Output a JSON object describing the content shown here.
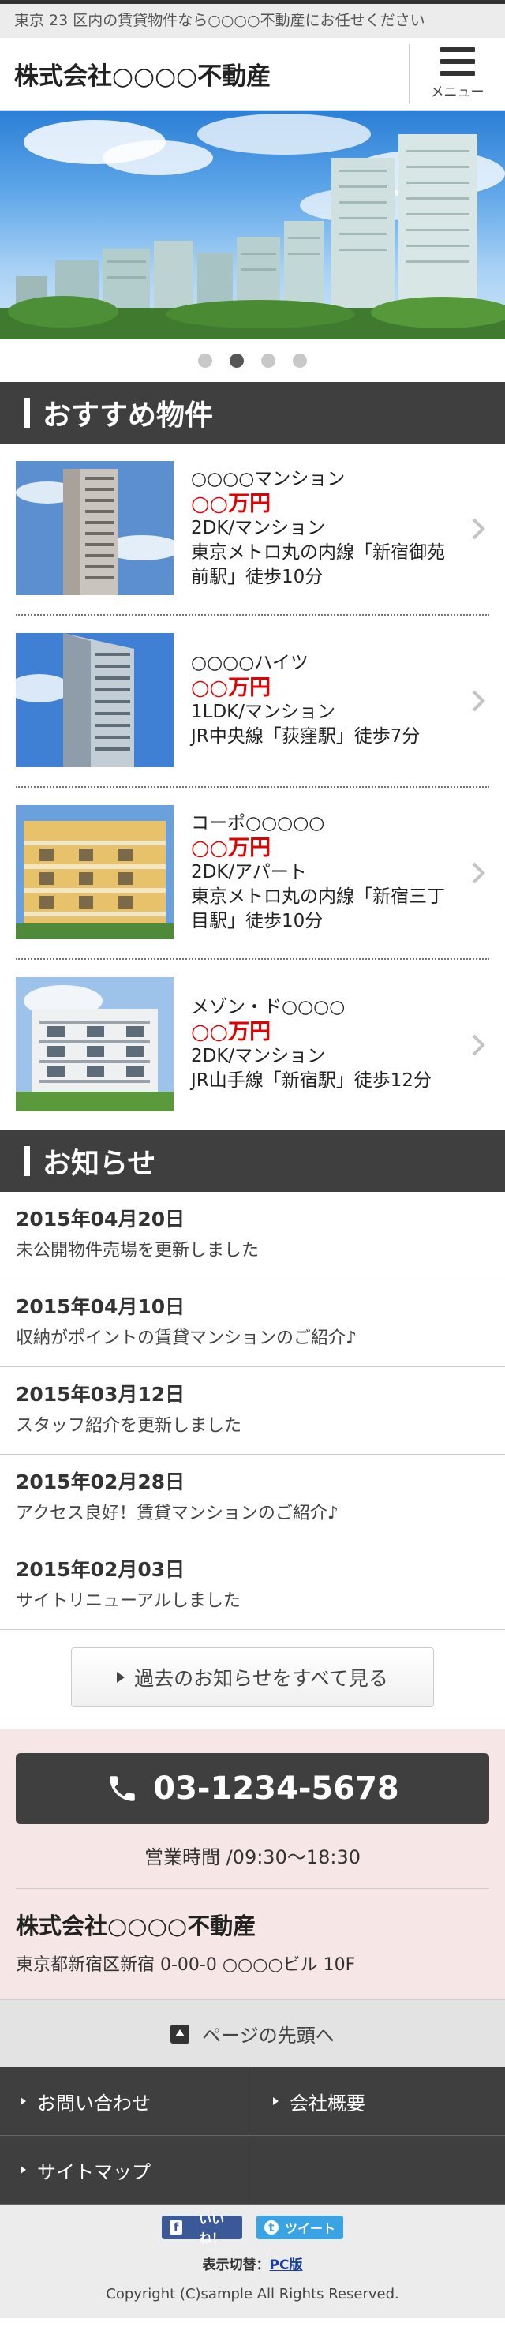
{
  "topbar": {
    "text": "東京 23 区内の賃貸物件なら○○○○不動産にお任せください"
  },
  "header": {
    "title": "株式会社○○○○不動産",
    "menu_label": "メニュー"
  },
  "slider": {
    "dots": 4,
    "active": 1
  },
  "recommend": {
    "heading": "おすすめ物件",
    "items": [
      {
        "name": "○○○○マンション",
        "price": "○○万円",
        "type": "2DK/マンション",
        "access": "東京メトロ丸の内線「新宿御苑前駅」徒歩10分"
      },
      {
        "name": "○○○○ハイツ",
        "price": "○○万円",
        "type": "1LDK/マンション",
        "access": "JR中央線「荻窪駅」徒歩7分"
      },
      {
        "name": "コーポ○○○○○",
        "price": "○○万円",
        "type": "2DK/アパート",
        "access": "東京メトロ丸の内線「新宿三丁目駅」徒歩10分"
      },
      {
        "name": "メゾン・ド○○○○",
        "price": "○○万円",
        "type": "2DK/マンション",
        "access": "JR山手線「新宿駅」徒歩12分"
      }
    ]
  },
  "news": {
    "heading": "お知らせ",
    "items": [
      {
        "date": "2015年04月20日",
        "title": "未公開物件売場を更新しました"
      },
      {
        "date": "2015年04月10日",
        "title": "収納がポイントの賃貸マンションのご紹介♪"
      },
      {
        "date": "2015年03月12日",
        "title": "スタッフ紹介を更新しました"
      },
      {
        "date": "2015年02月28日",
        "title": "アクセス良好！賃貸マンションのご紹介♪"
      },
      {
        "date": "2015年02月03日",
        "title": "サイトリニューアルしました"
      }
    ],
    "more_label": "過去のお知らせをすべて見る"
  },
  "contact": {
    "phone": "03-1234-5678",
    "hours": "営業時間 /09:30〜18:30",
    "company_name": "株式会社○○○○不動産",
    "address": "東京都新宿区新宿 0-00-0 ○○○○ビル 10F"
  },
  "pagetop": {
    "label": "ページの先頭へ"
  },
  "footer_nav": {
    "contact": "お問い合わせ",
    "about": "会社概要",
    "sitemap": "サイトマップ"
  },
  "social": {
    "like": "いいね！",
    "tweet": "ツイート"
  },
  "display": {
    "label": "表示切替：",
    "link": "PC版"
  },
  "copyright": "Copyright (C)sample All Rights Reserved.",
  "colors": {
    "dark": "#3f3f3f",
    "price_red": "#e20000",
    "contact_bg": "#f6e6e6",
    "facebook": "#3b5998",
    "twitter": "#3aa3e3"
  }
}
